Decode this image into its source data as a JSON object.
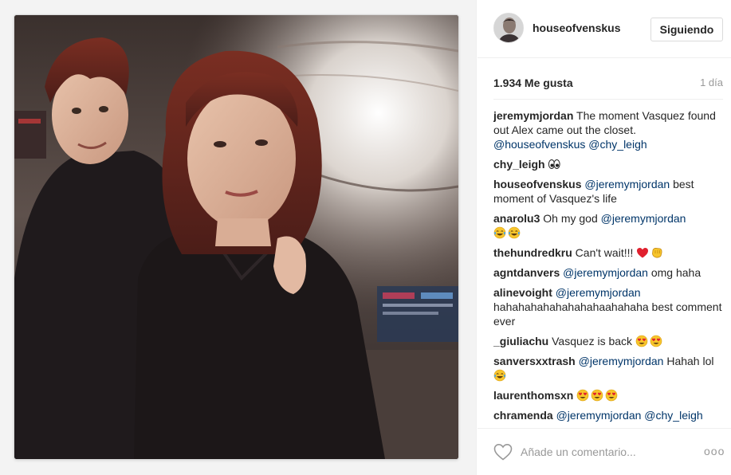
{
  "post": {
    "author": "houseofvenskus",
    "follow_label": "Siguiendo",
    "likes": "1.934 Me gusta",
    "time_ago": "1 día",
    "comment_placeholder": "Añade un comentario...",
    "more_label": "ooo"
  },
  "comments": [
    {
      "author": "jeremymjordan",
      "text": " The moment Vasquez found out Alex came out the closet. ",
      "mentions": [
        "@houseofvenskus",
        "@chy_leigh"
      ]
    },
    {
      "author": "chy_leigh",
      "emoji": [
        "eyes-emoji"
      ]
    },
    {
      "author": "houseofvenskus",
      "mention": "@jeremymjordan",
      "text": " best moment of Vasquez's life"
    },
    {
      "author": "anarolu3",
      "text": " Oh my god ",
      "mention": "@jeremymjordan",
      "emoji": [
        "tears-of-joy-emoji",
        "tears-of-joy-emoji"
      ]
    },
    {
      "author": "thehundredkru",
      "text": " Can't wait!!! ",
      "emoji": [
        "red-heart-emoji",
        "fist-bump-emoji"
      ]
    },
    {
      "author": "agntdanvers",
      "mention": "@jeremymjordan",
      "text": " omg haha"
    },
    {
      "author": "alinevoight",
      "mention": "@jeremymjordan",
      "text": " hahahahahahahahahaahahaha best comment ever"
    },
    {
      "author": "_giuliachu",
      "text": " Vasquez is back ",
      "emoji": [
        "heart-eyes-emoji",
        "heart-eyes-emoji"
      ]
    },
    {
      "author": "sanversxxtrash",
      "mention": "@jeremymjordan",
      "text": " Hahah lol",
      "emoji": [
        "tears-of-joy-emoji"
      ]
    },
    {
      "author": "laurenthomsxn",
      "emoji": [
        "heart-eyes-emoji",
        "heart-eyes-emoji",
        "heart-eyes-emoji"
      ]
    },
    {
      "author": "chramenda",
      "mentions": [
        "@jeremymjordan",
        "@chy_leigh"
      ]
    }
  ],
  "colors": {
    "mention": "#003569",
    "muted": "#999999",
    "border": "#efefef"
  }
}
